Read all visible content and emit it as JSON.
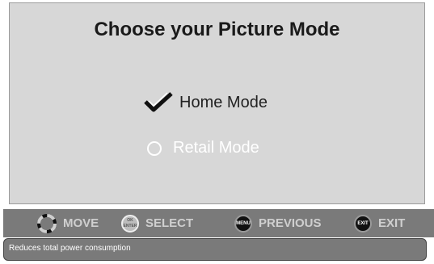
{
  "title": "Choose your Picture Mode",
  "options": [
    {
      "label": "Home Mode",
      "selected": true
    },
    {
      "label": "Retail Mode",
      "selected": false
    }
  ],
  "nav": {
    "move": {
      "label": "MOVE",
      "icon": "dpad-icon"
    },
    "select": {
      "label": "SELECT",
      "key": "OK",
      "key2": "ENTER",
      "icon": "ok-enter-button-icon"
    },
    "previous": {
      "label": "PREVIOUS",
      "key": "MENU",
      "icon": "menu-button-icon"
    },
    "exit": {
      "label": "EXIT",
      "key": "EXIT",
      "icon": "exit-button-icon"
    }
  },
  "info": "Reduces total power consumption",
  "colors": {
    "panel": "#d7d7d7",
    "bar": "#7a7a7a",
    "selected_text": "#222222",
    "unselected_text": "#ffffff"
  }
}
